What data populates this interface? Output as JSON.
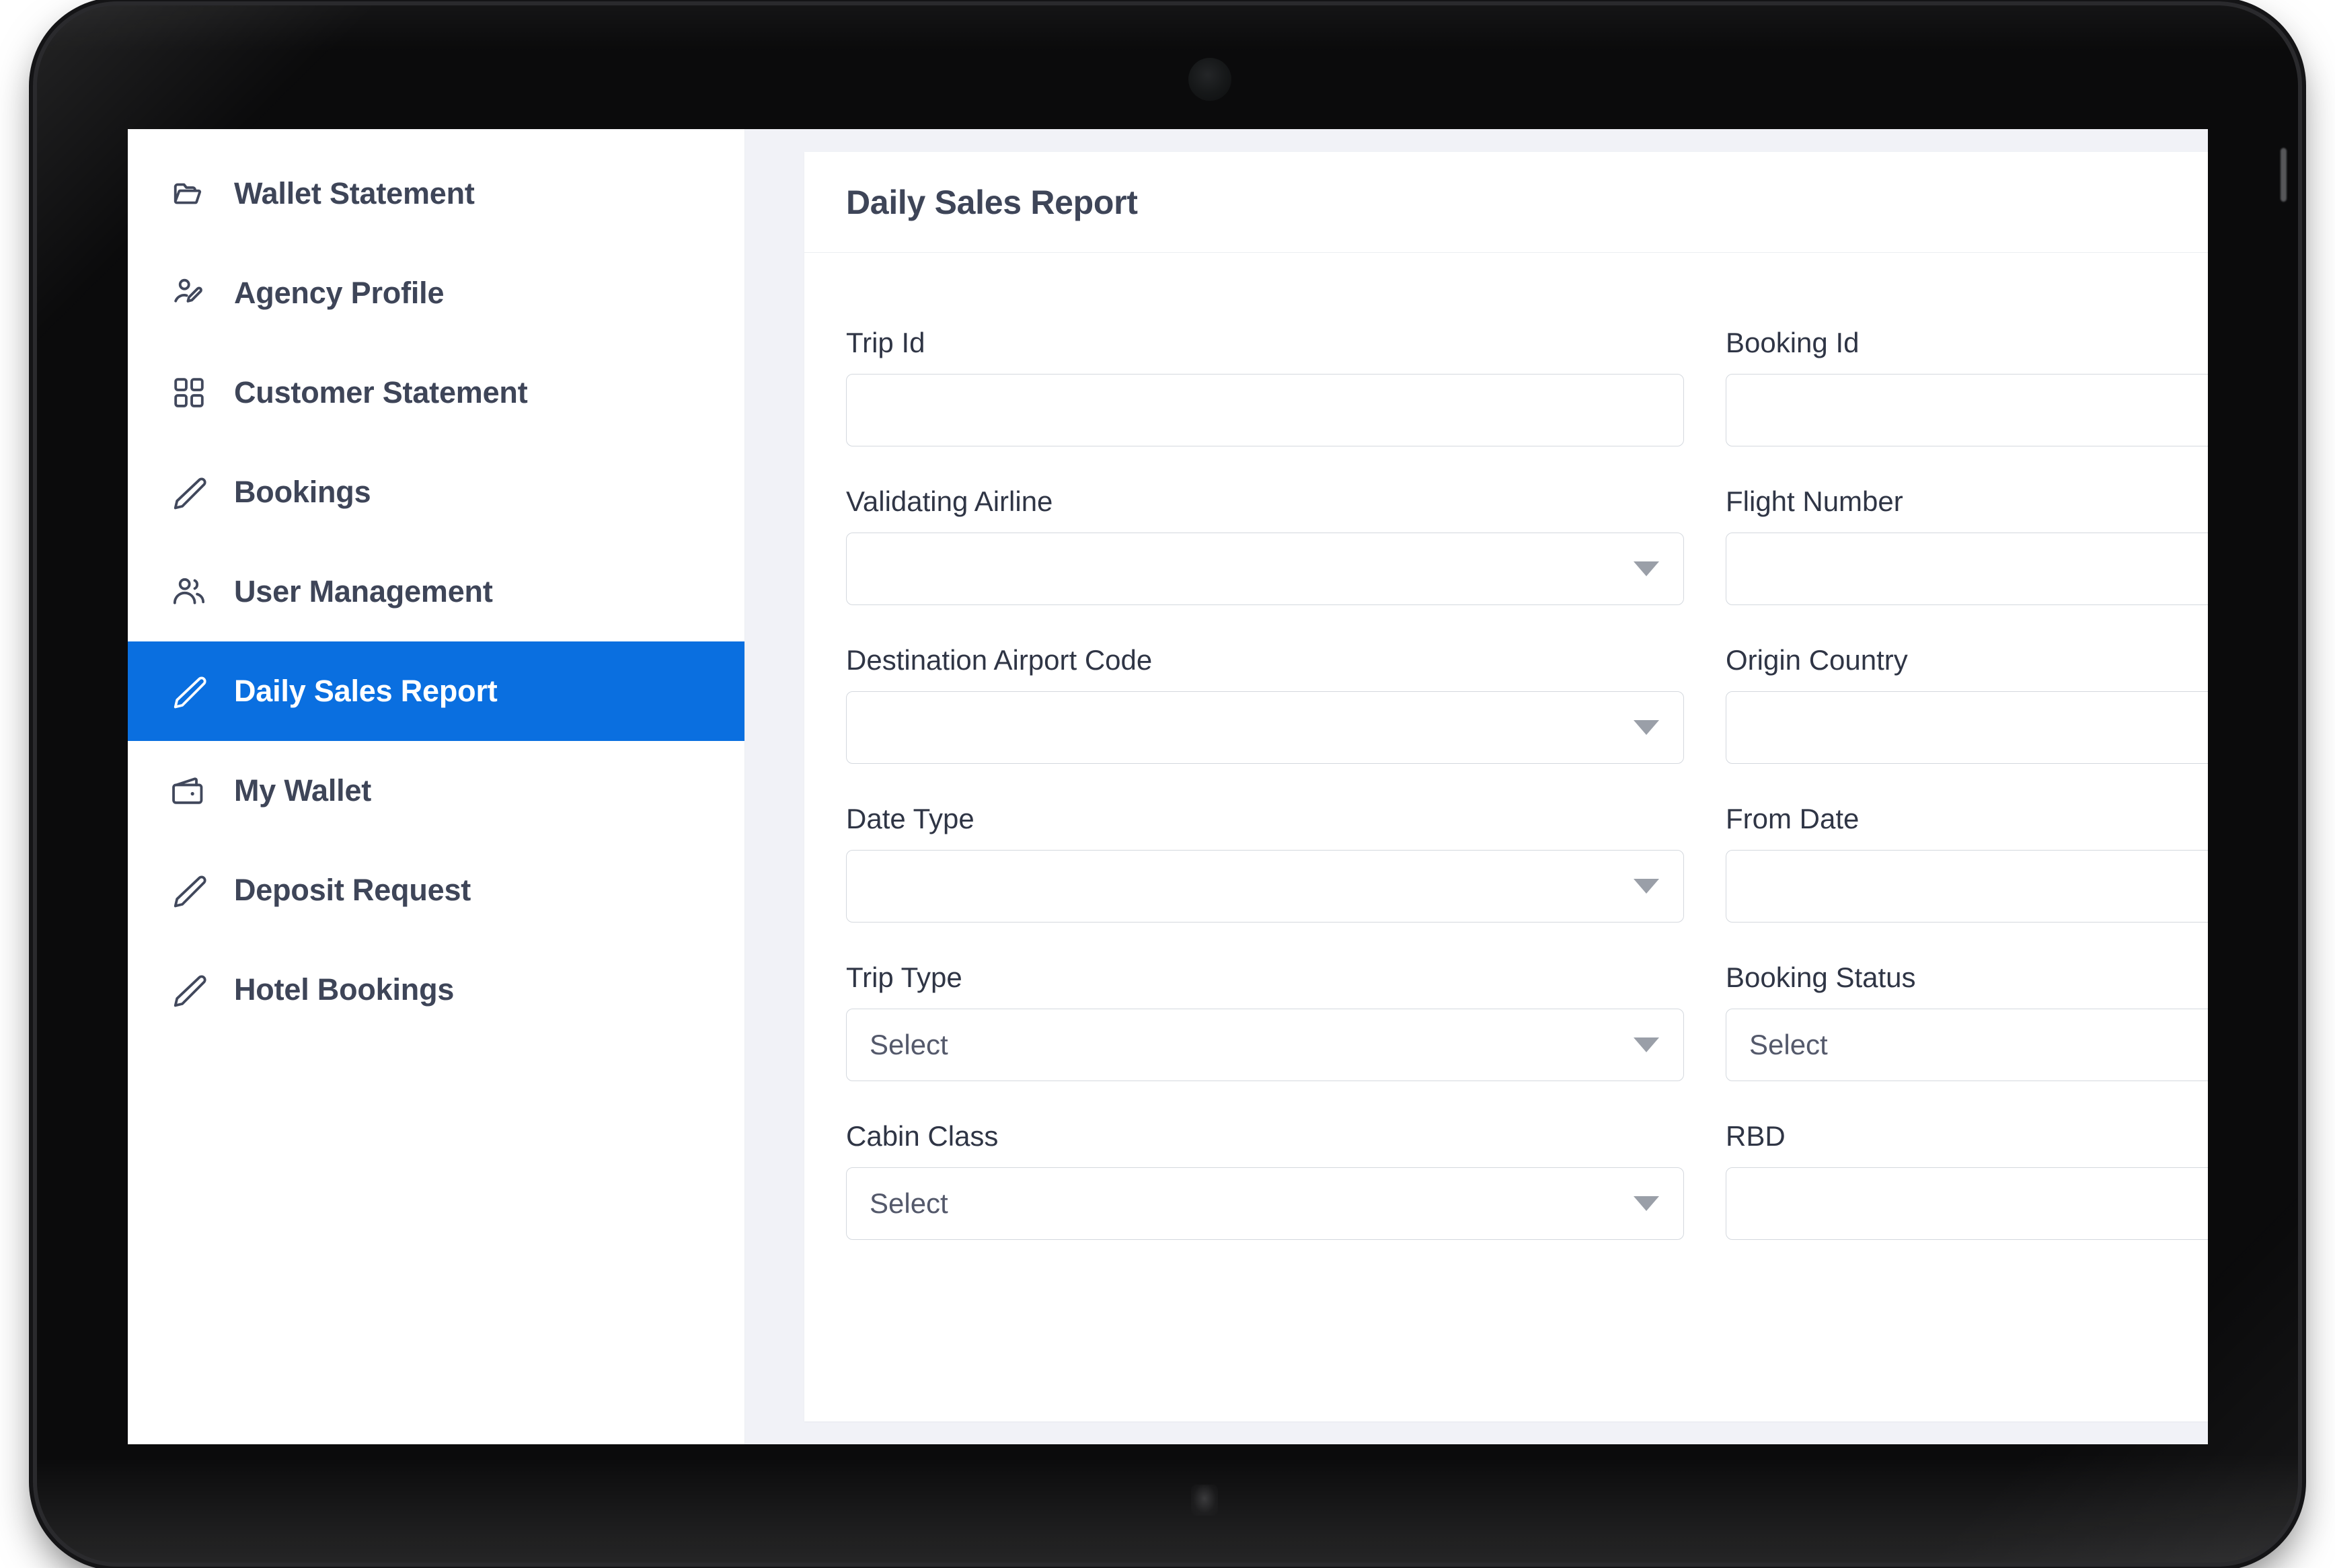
{
  "device": {
    "camera_icon": "front-camera",
    "home_indicator_icon": "home-indicator"
  },
  "sidebar": {
    "items": [
      {
        "label": "Wallet Statement",
        "icon": "folder-open-icon",
        "active": false
      },
      {
        "label": "Agency Profile",
        "icon": "user-edit-icon",
        "active": false
      },
      {
        "label": "Customer Statement",
        "icon": "grid-icon",
        "active": false
      },
      {
        "label": "Bookings",
        "icon": "pencil-icon",
        "active": false
      },
      {
        "label": "User Management",
        "icon": "users-icon",
        "active": false
      },
      {
        "label": "Daily Sales Report",
        "icon": "pencil-icon",
        "active": true
      },
      {
        "label": "My Wallet",
        "icon": "wallet-icon",
        "active": false
      },
      {
        "label": "Deposit Request",
        "icon": "pencil-icon",
        "active": false
      },
      {
        "label": "Hotel Bookings",
        "icon": "pencil-icon",
        "active": false
      }
    ]
  },
  "main": {
    "title": "Daily Sales Report",
    "fields": [
      {
        "label": "Trip Id",
        "type": "text",
        "value": "",
        "placeholder": ""
      },
      {
        "label": "Booking Id",
        "type": "text",
        "value": "",
        "placeholder": ""
      },
      {
        "label": "Validating Airline",
        "type": "select",
        "value": "",
        "placeholder": ""
      },
      {
        "label": "Flight Number",
        "type": "text",
        "value": "",
        "placeholder": ""
      },
      {
        "label": "Destination Airport Code",
        "type": "select",
        "value": "",
        "placeholder": ""
      },
      {
        "label": "Origin Country",
        "type": "text",
        "value": "",
        "placeholder": ""
      },
      {
        "label": "Date Type",
        "type": "select",
        "value": "",
        "placeholder": ""
      },
      {
        "label": "From Date",
        "type": "text",
        "value": "",
        "placeholder": ""
      },
      {
        "label": "Trip Type",
        "type": "select",
        "value": "Select",
        "placeholder": "Select"
      },
      {
        "label": "Booking Status",
        "type": "select",
        "value": "Select",
        "placeholder": "Select"
      },
      {
        "label": "Cabin Class",
        "type": "select",
        "value": "Select",
        "placeholder": "Select"
      },
      {
        "label": "RBD",
        "type": "text",
        "value": "",
        "placeholder": ""
      }
    ]
  },
  "colors": {
    "accent": "#0a6fe0",
    "page_background": "#f1f2f7",
    "card_background": "#ffffff",
    "text_primary": "#3e4558",
    "label_text": "#2f3545",
    "input_border": "#d4d8de",
    "bezel": "#0b0b0c"
  }
}
